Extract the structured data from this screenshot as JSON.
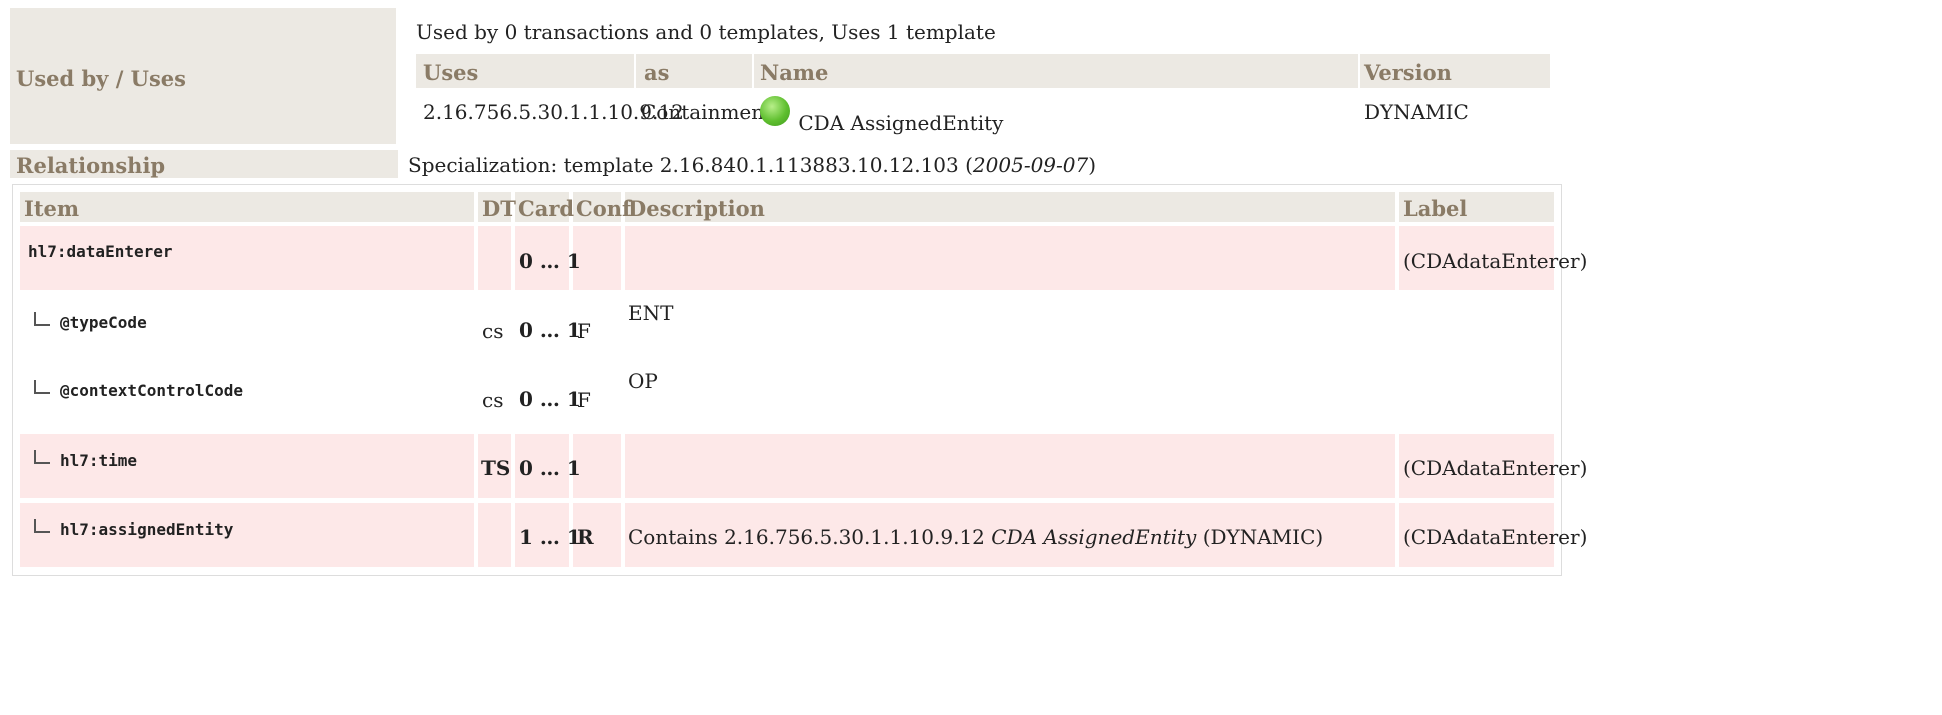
{
  "meta": {
    "used_by_label": "Used by / Uses",
    "summary": "Used by 0 transactions and 0 templates, Uses 1 template",
    "uses_headers": {
      "uses": "Uses",
      "as": "as",
      "name": "Name",
      "version": "Version"
    },
    "uses_row": {
      "oid": "2.16.756.5.30.1.1.10.9.12",
      "as": "Containment",
      "name": "CDA AssignedEntity",
      "version": "DYNAMIC"
    },
    "relationship_label": "Relationship",
    "relationship_text": "Specialization: template 2.16.840.1.113883.10.12.103 (",
    "relationship_date": "2005-09-07",
    "relationship_close": ")"
  },
  "table": {
    "headers": {
      "item": "Item",
      "dt": "DT",
      "card": "Card",
      "conf": "Conf",
      "description": "Description",
      "label": "Label"
    },
    "rows": [
      {
        "item": "hl7:dataEnterer",
        "dt": "",
        "card": "0 … 1",
        "conf": "",
        "description": "",
        "label": "(CDAdataEnterer)"
      },
      {
        "item": "@typeCode",
        "dt": "cs",
        "card": "0 … 1",
        "conf": "F",
        "description": "ENT",
        "label": ""
      },
      {
        "item": "@contextControlCode",
        "dt": "cs",
        "card": "0 … 1",
        "conf": "F",
        "description": "OP",
        "label": ""
      },
      {
        "item": "hl7:time",
        "dt": "TS",
        "card": "0 … 1",
        "conf": "",
        "description": "",
        "label": "(CDAdataEnterer)"
      },
      {
        "item": "hl7:assignedEntity",
        "dt": "",
        "card": "1 … 1",
        "conf": "R",
        "desc_prefix": "Contains 2.16.756.5.30.1.1.10.9.12 ",
        "desc_name": "CDA AssignedEntity",
        "desc_suffix": " (DYNAMIC)",
        "label": "(CDAdataEnterer)"
      }
    ]
  }
}
